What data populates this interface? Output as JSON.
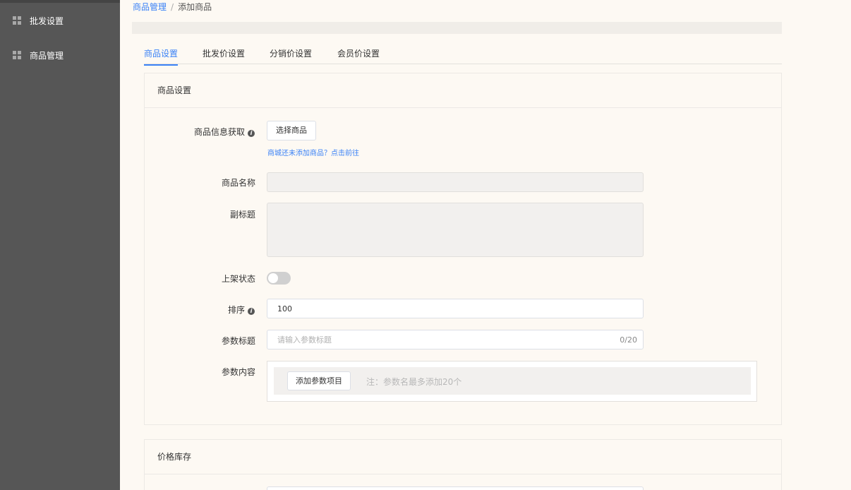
{
  "sidebar": {
    "items": [
      {
        "label": "批发设置",
        "icon": "grid-icon"
      },
      {
        "label": "商品管理",
        "icon": "grid-icon"
      }
    ]
  },
  "breadcrumb": {
    "parent": "商品管理",
    "separator": "/",
    "current": "添加商品"
  },
  "tabs": [
    {
      "label": "商品设置",
      "active": true
    },
    {
      "label": "批发价设置",
      "active": false
    },
    {
      "label": "分销价设置",
      "active": false
    },
    {
      "label": "会员价设置",
      "active": false
    }
  ],
  "sections": {
    "goods": {
      "title": "商品设置",
      "fetch": {
        "label": "商品信息获取",
        "button": "选择商品",
        "hint": "商城还未添加商品？点击前往"
      },
      "name": {
        "label": "商品名称",
        "value": ""
      },
      "subtitle": {
        "label": "副标题",
        "value": ""
      },
      "status": {
        "label": "上架状态",
        "on": false
      },
      "sort": {
        "label": "排序",
        "value": "100"
      },
      "param_title": {
        "label": "参数标题",
        "placeholder": "请输入参数标题",
        "counter": "0/20"
      },
      "param_content": {
        "label": "参数内容",
        "button": "添加参数项目",
        "note": "注：参数名最多添加20个"
      }
    },
    "stock": {
      "title": "价格库存"
    }
  },
  "colors": {
    "accent": "#3b82f6",
    "sidebar_bg": "#565656",
    "page_bg": "#fdf9f3"
  }
}
